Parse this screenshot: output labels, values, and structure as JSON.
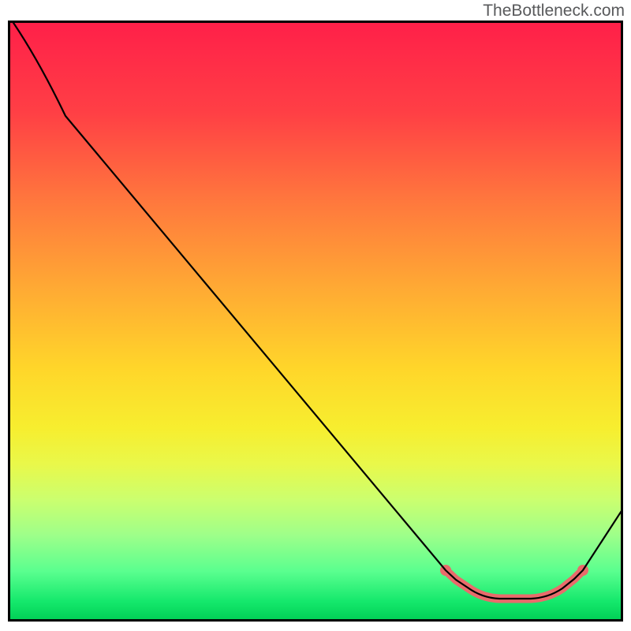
{
  "watermark": "TheBottleneck.com",
  "colors": {
    "curve": "#000000",
    "highlight": "#e96b6b",
    "border": "#000000",
    "watermark_text": "#58595b",
    "gradient_top": "#ff2049",
    "gradient_bottom": "#02d157"
  },
  "chart_data": {
    "type": "line",
    "title": "",
    "xlabel": "",
    "ylabel": "",
    "x_range_pct": [
      0,
      100
    ],
    "y_range_pct": [
      0,
      100
    ],
    "note": "Axes are unlabeled; values below are percentages of the plot box (x: 0=left..100=right, y: 0=top..100=bottom). The curve starts just above the top-left corner, descends near-linearly to a broad valley around x≈78–86%, then rises toward the right edge.",
    "series": [
      {
        "name": "bottleneck-curve",
        "x": [
          0,
          5,
          10,
          20,
          30,
          40,
          50,
          60,
          70,
          72,
          75,
          78,
          80,
          82,
          84,
          86,
          88,
          90,
          92,
          94,
          96,
          98,
          100
        ],
        "y": [
          -1,
          6,
          16,
          30,
          43,
          56,
          69,
          82,
          90,
          92,
          94,
          95.5,
          96.2,
          96.6,
          96.6,
          96.2,
          95.5,
          94,
          93,
          92,
          88,
          84,
          80
        ]
      }
    ],
    "highlight_segment": {
      "series": "bottleneck-curve",
      "x_start_pct": 71,
      "x_end_pct": 94,
      "color": "#e96b6b",
      "end_markers": true
    },
    "background": {
      "kind": "vertical-gradient",
      "stops": [
        {
          "pct": 0,
          "color": "#ff2049"
        },
        {
          "pct": 30,
          "color": "#ff783d"
        },
        {
          "pct": 58,
          "color": "#ffd62a"
        },
        {
          "pct": 80,
          "color": "#cbff6f"
        },
        {
          "pct": 100,
          "color": "#02d157"
        }
      ]
    }
  }
}
